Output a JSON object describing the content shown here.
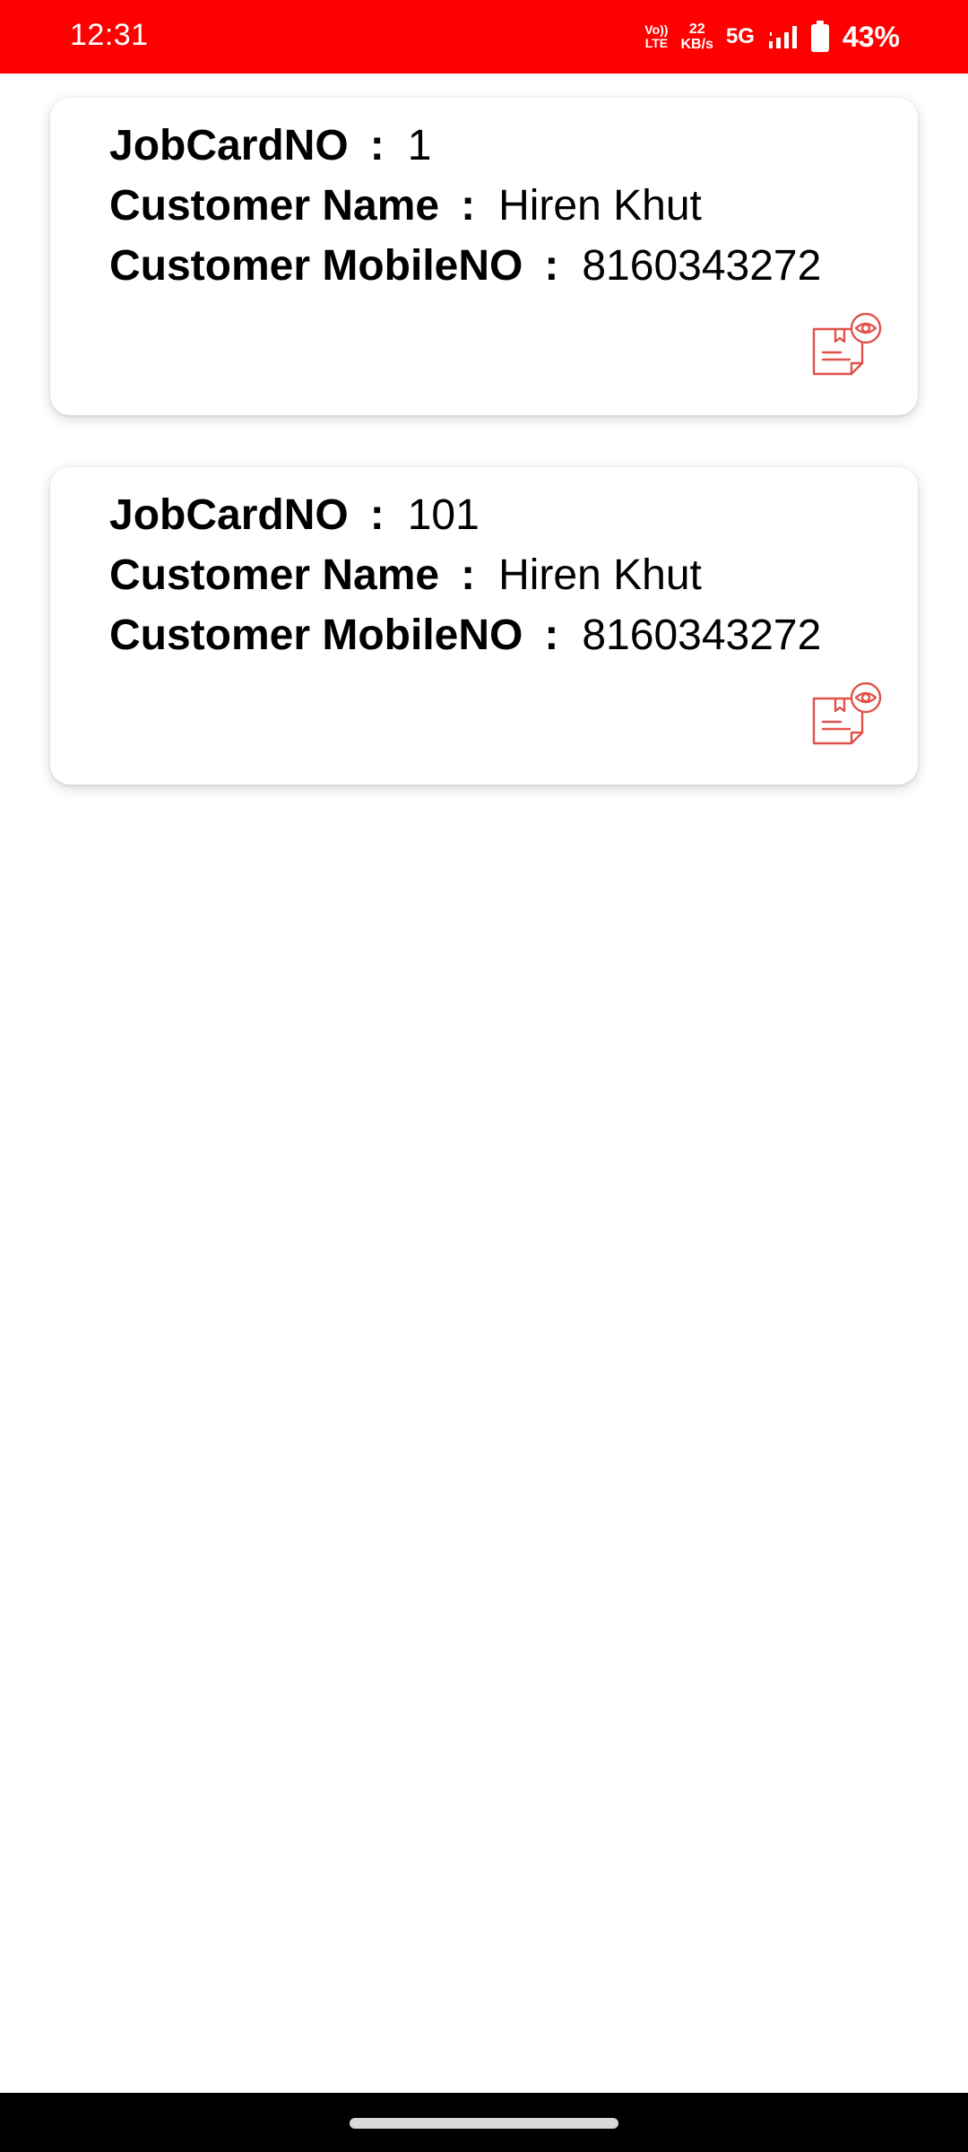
{
  "status_bar": {
    "time": "12:31",
    "volte_top": "Vo))",
    "volte_bottom": "LTE",
    "speed_value": "22",
    "speed_unit": "KB/s",
    "network": "5G",
    "battery": "43%",
    "background_color": "#ff0000"
  },
  "job_cards": [
    {
      "jobcard_label": "JobCardNO",
      "jobcard_value": "1",
      "customer_name_label": "Customer Name",
      "customer_name_value": "Hiren Khut",
      "mobile_label": "Customer MobileNO",
      "mobile_value": "8160343272",
      "view_icon": "document-eye-icon"
    },
    {
      "jobcard_label": "JobCardNO",
      "jobcard_value": "101",
      "customer_name_label": "Customer Name",
      "customer_name_value": "Hiren Khut",
      "mobile_label": "Customer MobileNO",
      "mobile_value": "8160343272",
      "view_icon": "document-eye-icon"
    }
  ],
  "separator": ":",
  "accent_color": "#e0524a"
}
